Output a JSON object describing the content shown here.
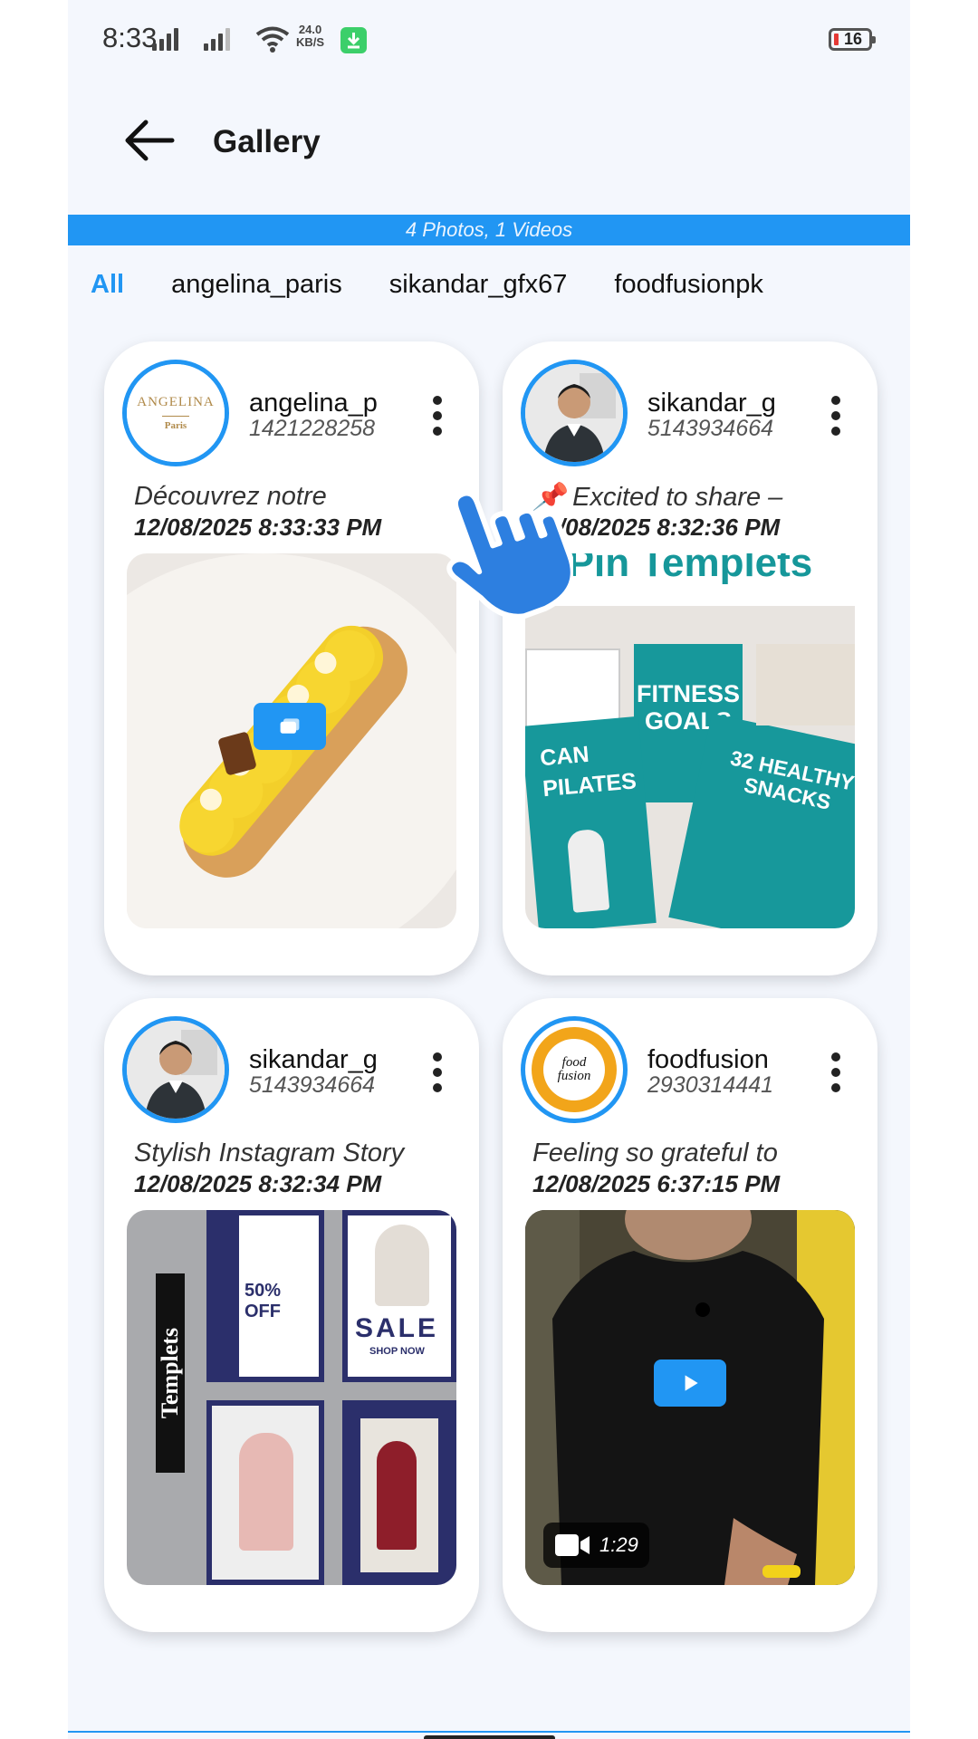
{
  "status_bar": {
    "time": "8:33",
    "net_speed_value": "24.0",
    "net_speed_unit": "KB/S",
    "battery": "16"
  },
  "header": {
    "title": "Gallery",
    "back_icon": "arrow-left-icon"
  },
  "banner": {
    "text": "4 Photos, 1 Videos"
  },
  "filter_tabs": [
    {
      "label": "All",
      "active": true
    },
    {
      "label": "angelina_paris",
      "active": false
    },
    {
      "label": "sikandar_gfx67",
      "active": false
    },
    {
      "label": "foodfusionpk",
      "active": false
    }
  ],
  "posts": [
    {
      "username": "angelina_p",
      "user_id": "1421228258",
      "caption": "Découvrez notre",
      "date": "12/08/2025 8:33:33 PM",
      "media_type": "carousel",
      "avatar_text": "ANGELINA",
      "avatar_subtext": "Paris"
    },
    {
      "username": "sikandar_g",
      "user_id": "5143934664",
      "caption": "📌 Excited to share –",
      "date": "12/08/2025 8:32:36 PM",
      "media_type": "image",
      "thumb_title": "Pin Templets",
      "thumb_texts": [
        "FITNESS GOALS",
        "CAN PILATES",
        "32 HEALTHY SNACKS"
      ]
    },
    {
      "username": "sikandar_g",
      "user_id": "5143934664",
      "caption": "Stylish Instagram Story",
      "date": "12/08/2025 8:32:34 PM",
      "media_type": "image",
      "thumb_texts": [
        "Templets",
        "50% OFF",
        "SALE",
        "SHOP NOW"
      ]
    },
    {
      "username": "foodfusion",
      "user_id": "2930314441",
      "caption": "Feeling so grateful to",
      "date": "12/08/2025 6:37:15 PM",
      "media_type": "video",
      "duration": "1:29",
      "avatar_text": "food fusion"
    }
  ],
  "colors": {
    "accent": "#2196f3",
    "background": "#f4f7fd"
  }
}
